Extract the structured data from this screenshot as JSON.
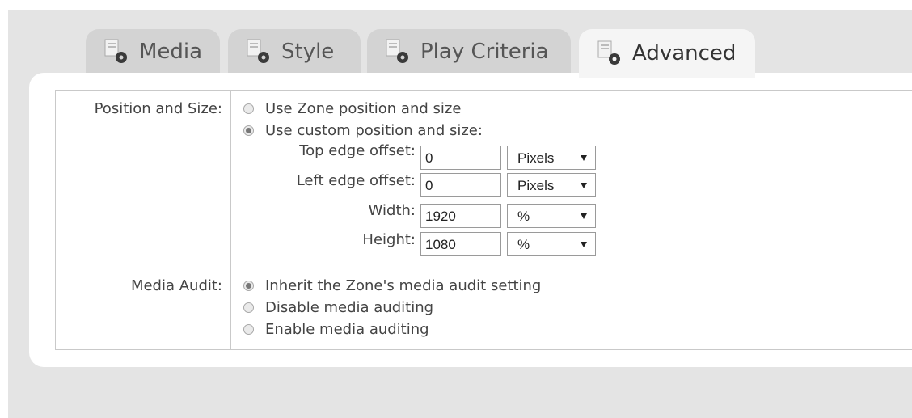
{
  "tabs": [
    {
      "label": "Media",
      "icon": "media-settings-icon"
    },
    {
      "label": "Style",
      "icon": "media-settings-icon"
    },
    {
      "label": "Play Criteria",
      "icon": "media-settings-icon"
    },
    {
      "label": "Advanced",
      "icon": "media-settings-icon",
      "active": true
    }
  ],
  "position": {
    "label": "Position and Size:",
    "options": [
      {
        "label": "Use Zone position and size",
        "checked": false
      },
      {
        "label": "Use custom position and size:",
        "checked": true
      }
    ],
    "fields": [
      {
        "label": "Top edge offset:",
        "value": "0",
        "unit": "Pixels"
      },
      {
        "label": "Left edge offset:",
        "value": "0",
        "unit": "Pixels"
      },
      {
        "label": "Width:",
        "value": "1920",
        "unit": "%"
      },
      {
        "label": "Height:",
        "value": "1080",
        "unit": "%"
      }
    ]
  },
  "audit": {
    "label": "Media Audit:",
    "options": [
      {
        "label": "Inherit the Zone's media audit setting",
        "checked": true
      },
      {
        "label": "Disable media auditing",
        "checked": false
      },
      {
        "label": "Enable media auditing",
        "checked": false
      }
    ]
  },
  "colors": {
    "backdrop": "#e4e4e4",
    "tab_inactive": "#d3d3d3",
    "tab_active": "#f5f5f5",
    "icon_accent": "#333333"
  }
}
